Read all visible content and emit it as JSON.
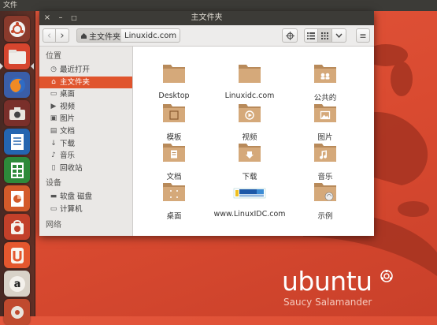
{
  "top_panel": {
    "menu_label": "文件"
  },
  "launcher": {
    "items": [
      "ubuntu-dash-icon",
      "files-icon",
      "firefox-icon",
      "shotwell-icon",
      "libreoffice-writer-icon",
      "libreoffice-calc-icon",
      "libreoffice-impress-icon",
      "software-center-icon",
      "ubuntu-one-icon",
      "amazon-icon",
      "settings-icon"
    ]
  },
  "window": {
    "title": "主文件夹",
    "close_symbol": "×",
    "minimize_symbol": "–",
    "maximize_symbol": "□"
  },
  "toolbar": {
    "back_symbol": "‹",
    "forward_symbol": "›",
    "breadcrumbs": [
      "主文件夹",
      "Linuxidc.com"
    ],
    "menu_symbol": "≡"
  },
  "sidebar": {
    "sections": [
      {
        "heading": "位置",
        "items": [
          {
            "icon": "clock-icon",
            "glyph": "◷",
            "label": "最近打开"
          },
          {
            "icon": "home-icon",
            "glyph": "⌂",
            "label": "主文件夹",
            "selected": true
          },
          {
            "icon": "desktop-icon",
            "glyph": "▭",
            "label": "桌面"
          },
          {
            "icon": "video-icon",
            "glyph": "▶",
            "label": "视频"
          },
          {
            "icon": "picture-icon",
            "glyph": "▣",
            "label": "图片"
          },
          {
            "icon": "document-icon",
            "glyph": "▤",
            "label": "文档"
          },
          {
            "icon": "download-icon",
            "glyph": "↓",
            "label": "下载"
          },
          {
            "icon": "music-icon",
            "glyph": "♪",
            "label": "音乐"
          },
          {
            "icon": "trash-icon",
            "glyph": "▯",
            "label": "回收站"
          }
        ]
      },
      {
        "heading": "设备",
        "items": [
          {
            "icon": "floppy-icon",
            "glyph": "▬",
            "label": "软盘 磁盘"
          },
          {
            "icon": "computer-icon",
            "glyph": "▭",
            "label": "计算机"
          }
        ]
      },
      {
        "heading": "网络",
        "items": []
      }
    ]
  },
  "files": [
    {
      "label": "Desktop",
      "emblem": ""
    },
    {
      "label": "Linuxidc.com",
      "emblem": ""
    },
    {
      "label": "公共的",
      "emblem": "people"
    },
    {
      "label": "模板",
      "emblem": "template"
    },
    {
      "label": "视频",
      "emblem": "video"
    },
    {
      "label": "图片",
      "emblem": "picture"
    },
    {
      "label": "文档",
      "emblem": "document"
    },
    {
      "label": "下载",
      "emblem": "download"
    },
    {
      "label": "音乐",
      "emblem": "music"
    },
    {
      "label": "桌面",
      "emblem": "dots"
    },
    {
      "label": "www.LinuxIDC.com",
      "emblem": "logo"
    },
    {
      "label": "示例",
      "emblem": "examples"
    }
  ],
  "desktop": {
    "brand": "ubuntu",
    "release": "Saucy Salamander"
  },
  "colors": {
    "accent": "#e0542d",
    "folder": "#d5a97a",
    "folder_dark": "#b88a5a",
    "wallpaper": "#d94a30"
  }
}
